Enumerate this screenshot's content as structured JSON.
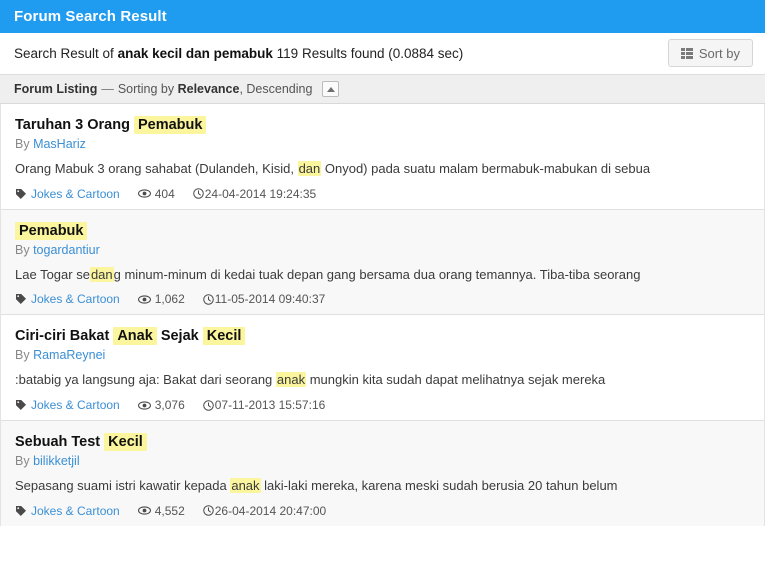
{
  "window": {
    "title": "Forum Search Result",
    "accent_color": "#1F9BEF"
  },
  "summary": {
    "prefix": "Search Result of",
    "query": "anak kecil dan pemabuk",
    "suffix": "119 Results found (0.0884 sec)",
    "result_count": "119",
    "elapsed": "(0.0884 sec)",
    "sort_button_label": "Sort by",
    "sort_button_icon": "th-list-icon"
  },
  "listing_bar": {
    "title": "Forum Listing",
    "dash": "—",
    "sorting_prefix": "Sorting by",
    "sort_field": "Relevance",
    "sort_direction": ", Descending",
    "collapse_icon": "chevron-up-icon"
  },
  "icons": {
    "tag": "tag-icon",
    "views": "eye-icon",
    "date": "clock-icon"
  },
  "results": [
    {
      "title_parts": [
        {
          "text": "Taruhan 3 Orang ",
          "hl": false
        },
        {
          "text": "Pemabuk",
          "hl": true
        }
      ],
      "title_plain": "Taruhan 3 Orang Pemabuk",
      "by_label": "By",
      "author": "MasHariz",
      "snippet_parts": [
        {
          "text": "Orang Mabuk 3 orang sahabat (Dulandeh, Kisid, ",
          "hl": false
        },
        {
          "text": "dan",
          "hl": true
        },
        {
          "text": " Onyod) pada suatu malam bermabuk-mabukan di sebua",
          "hl": false
        }
      ],
      "category": "Jokes & Cartoon",
      "views": "404",
      "date": "24-04-2014 19:24:35"
    },
    {
      "title_parts": [
        {
          "text": "Pemabuk",
          "hl": true
        }
      ],
      "title_plain": "Pemabuk",
      "by_label": "By",
      "author": "togardantiur",
      "snippet_parts": [
        {
          "text": "Lae Togar se",
          "hl": false
        },
        {
          "text": "dan",
          "hl": true
        },
        {
          "text": "g minum-minum di kedai tuak depan gang bersama dua orang temannya. Tiba-tiba seorang",
          "hl": false
        }
      ],
      "category": "Jokes & Cartoon",
      "views": "1,062",
      "date": "11-05-2014 09:40:37"
    },
    {
      "title_parts": [
        {
          "text": "Ciri-ciri Bakat ",
          "hl": false
        },
        {
          "text": "Anak",
          "hl": true
        },
        {
          "text": " Sejak ",
          "hl": false
        },
        {
          "text": "Kecil",
          "hl": true
        }
      ],
      "title_plain": "Ciri-ciri Bakat Anak Sejak Kecil",
      "by_label": "By",
      "author": "RamaReynei",
      "snippet_parts": [
        {
          "text": ":batabig ya langsung aja: Bakat dari seorang ",
          "hl": false
        },
        {
          "text": "anak",
          "hl": true
        },
        {
          "text": " mungkin kita sudah dapat melihatnya sejak mereka",
          "hl": false
        }
      ],
      "category": "Jokes & Cartoon",
      "views": "3,076",
      "date": "07-11-2013 15:57:16"
    },
    {
      "title_parts": [
        {
          "text": "Sebuah Test ",
          "hl": false
        },
        {
          "text": "Kecil",
          "hl": true
        }
      ],
      "title_plain": "Sebuah Test Kecil",
      "by_label": "By",
      "author": "bilikketjil",
      "snippet_parts": [
        {
          "text": "Sepasang suami istri kawatir kepada ",
          "hl": false
        },
        {
          "text": "anak",
          "hl": true
        },
        {
          "text": " laki-laki mereka, karena meski sudah berusia 20 tahun belum",
          "hl": false
        }
      ],
      "category": "Jokes & Cartoon",
      "views": "4,552",
      "date": "26-04-2014 20:47:00"
    }
  ]
}
